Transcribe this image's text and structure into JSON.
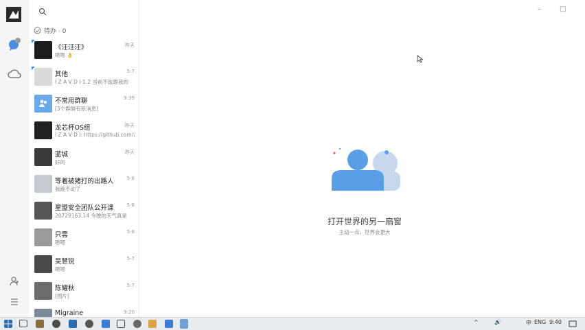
{
  "sidebar": {
    "icons": [
      "user-avatar",
      "chat-bubble-icon",
      "cloud-icon",
      "add-contact-icon",
      "menu-icon"
    ]
  },
  "list": {
    "todo_label": "待办 · 0",
    "items": [
      {
        "name": "《汪汪汪》",
        "msg": "嗯嗯 👌",
        "time": "昨天",
        "pinned": true,
        "color": "#1d1d1d"
      },
      {
        "name": "其他",
        "msg": "I Z A V D I-1.2 当前不能跟我的",
        "time": "5-7",
        "pinned": true,
        "color": "#d9d9d9"
      },
      {
        "name": "不常用群聊",
        "msg": "[3个群聊有新消息]",
        "time": "9:39",
        "pinned": false,
        "color": "#6aa8ec"
      },
      {
        "name": "龙芯杯OS组",
        "msg": "I Z A V D I: https://github.com/z4",
        "time": "昨天",
        "pinned": false,
        "color": "#222222"
      },
      {
        "name": "蓝城",
        "msg": "好的",
        "time": "昨天",
        "pinned": false,
        "color": "#3a3a3a"
      },
      {
        "name": "等着被猪打的出路人",
        "msg": "我跑不动了",
        "time": "5-8",
        "pinned": false,
        "color": "#c4c9d2"
      },
      {
        "name": "星盟安全团队公开课",
        "msg": "20729163.14 今晚的天气真是",
        "time": "5-8",
        "pinned": false,
        "color": "#555555"
      },
      {
        "name": "只雲",
        "msg": "嗯嗯",
        "time": "5-8",
        "pinned": false,
        "color": "#9a9a9a"
      },
      {
        "name": "吴慧锐",
        "msg": "嗯嗯",
        "time": "5-7",
        "pinned": false,
        "color": "#4a4a4a"
      },
      {
        "name": "陈耀秋",
        "msg": "[图片]",
        "time": "5-7",
        "pinned": false,
        "color": "#6b6b6b"
      },
      {
        "name": "Migraine",
        "msg": "",
        "time": "9:20",
        "pinned": false,
        "color": "#7a8a9a"
      }
    ]
  },
  "main": {
    "empty_title": "打开世界的另一扇窗",
    "empty_sub": "主动一点，世界会更大"
  },
  "window_controls": [
    "–",
    "□",
    "✕"
  ],
  "taskbar": {
    "time": "9:40",
    "apps": [
      "start-icon",
      "task-view-icon",
      "files-icon",
      "chrome-icon",
      "edge-icon",
      "qq-icon",
      "shield-icon",
      "copy-icon",
      "settings-icon",
      "explorer-icon",
      "mail-icon",
      "store-icon",
      "pinned-app-icon"
    ],
    "tray": [
      "^",
      "🔊",
      "中",
      "ENG"
    ]
  },
  "colors": {
    "accent": "#4a90e2",
    "sidebar_bg": "#f5f5f7",
    "illustration": "#5a9ee8"
  }
}
